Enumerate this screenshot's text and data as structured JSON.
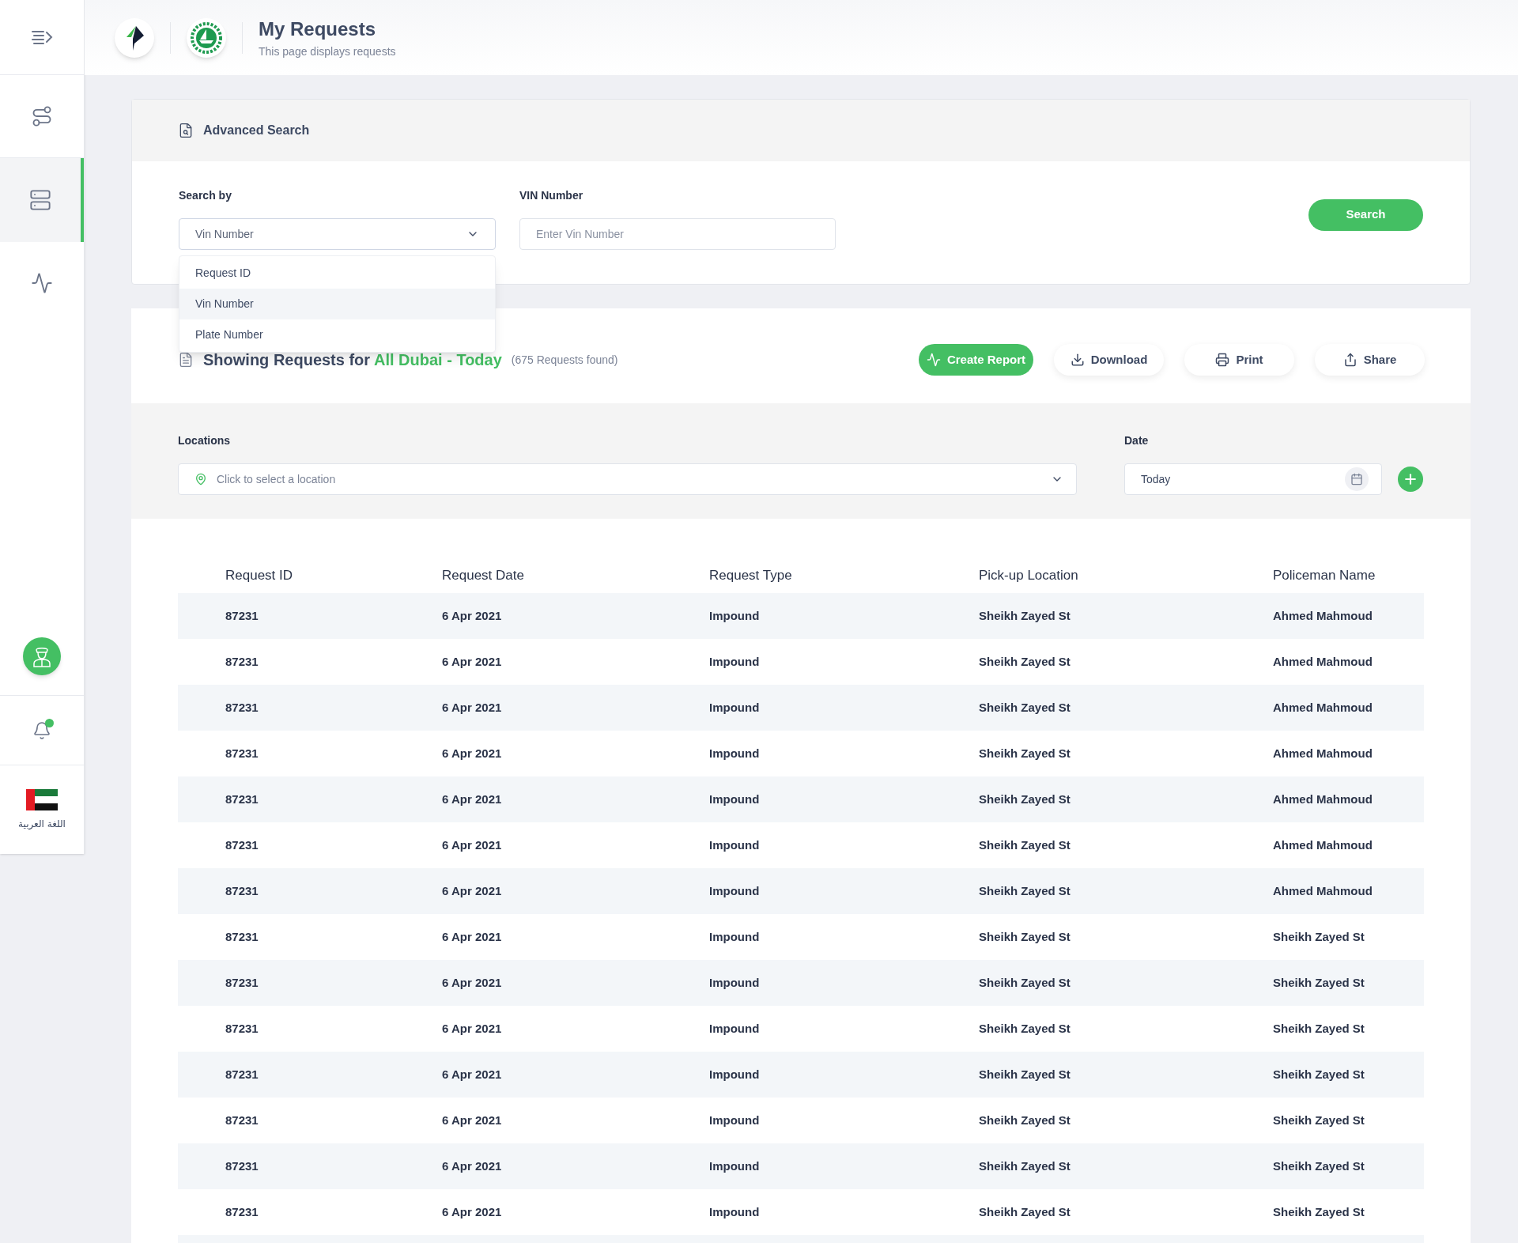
{
  "sidebar": {
    "items": [
      {
        "kind": "menu",
        "selected": false
      },
      {
        "kind": "route",
        "selected": false
      },
      {
        "kind": "server",
        "selected": true
      },
      {
        "kind": "activity",
        "selected": false
      }
    ],
    "notification_dot": true,
    "language": "اللغة العربية"
  },
  "header": {
    "title": "My Requests",
    "subtitle": "This page displays requests"
  },
  "advanced_search": {
    "title": "Advanced Search",
    "search_by": {
      "label": "Search by",
      "value": "Vin Number",
      "expanded": true,
      "options": [
        {
          "label": "Request ID",
          "selected": false
        },
        {
          "label": "Vin Number",
          "selected": true
        },
        {
          "label": "Plate Number",
          "selected": false
        }
      ]
    },
    "vin": {
      "label": "VIN Number",
      "placeholder": "Enter Vin Number"
    },
    "button": "Search"
  },
  "results": {
    "heading": "Showing Requests for",
    "scope": "All Dubai - Today",
    "count": "(675 Requests found)",
    "actions": [
      {
        "kind": "report",
        "label": "Create Report"
      },
      {
        "kind": "download",
        "label": "Download"
      },
      {
        "kind": "print",
        "label": "Print"
      },
      {
        "kind": "share",
        "label": "Share"
      }
    ]
  },
  "filters": {
    "locations": {
      "label": "Locations",
      "placeholder": "Click to select a location"
    },
    "date": {
      "label": "Date",
      "value": "Today"
    }
  },
  "table": {
    "columns": [
      "Request ID",
      "Request Date",
      "Request Type",
      "Pick-up Location",
      "Policeman Name"
    ],
    "rows": [
      [
        "87231",
        "6 Apr 2021",
        "Impound",
        "Sheikh Zayed St",
        "Ahmed Mahmoud"
      ],
      [
        "87231",
        "6 Apr 2021",
        "Impound",
        "Sheikh Zayed St",
        "Ahmed Mahmoud"
      ],
      [
        "87231",
        "6 Apr 2021",
        "Impound",
        "Sheikh Zayed St",
        "Ahmed Mahmoud"
      ],
      [
        "87231",
        "6 Apr 2021",
        "Impound",
        "Sheikh Zayed St",
        "Ahmed Mahmoud"
      ],
      [
        "87231",
        "6 Apr 2021",
        "Impound",
        "Sheikh Zayed St",
        "Ahmed Mahmoud"
      ],
      [
        "87231",
        "6 Apr 2021",
        "Impound",
        "Sheikh Zayed St",
        "Ahmed Mahmoud"
      ],
      [
        "87231",
        "6 Apr 2021",
        "Impound",
        "Sheikh Zayed St",
        "Ahmed Mahmoud"
      ],
      [
        "87231",
        "6 Apr 2021",
        "Impound",
        "Sheikh Zayed St",
        "Sheikh Zayed St"
      ],
      [
        "87231",
        "6 Apr 2021",
        "Impound",
        "Sheikh Zayed St",
        "Sheikh Zayed St"
      ],
      [
        "87231",
        "6 Apr 2021",
        "Impound",
        "Sheikh Zayed St",
        "Sheikh Zayed St"
      ],
      [
        "87231",
        "6 Apr 2021",
        "Impound",
        "Sheikh Zayed St",
        "Sheikh Zayed St"
      ],
      [
        "87231",
        "6 Apr 2021",
        "Impound",
        "Sheikh Zayed St",
        "Sheikh Zayed St"
      ],
      [
        "87231",
        "6 Apr 2021",
        "Impound",
        "Sheikh Zayed St",
        "Sheikh Zayed St"
      ],
      [
        "87231",
        "6 Apr 2021",
        "Impound",
        "Sheikh Zayed St",
        "Sheikh Zayed St"
      ]
    ]
  }
}
